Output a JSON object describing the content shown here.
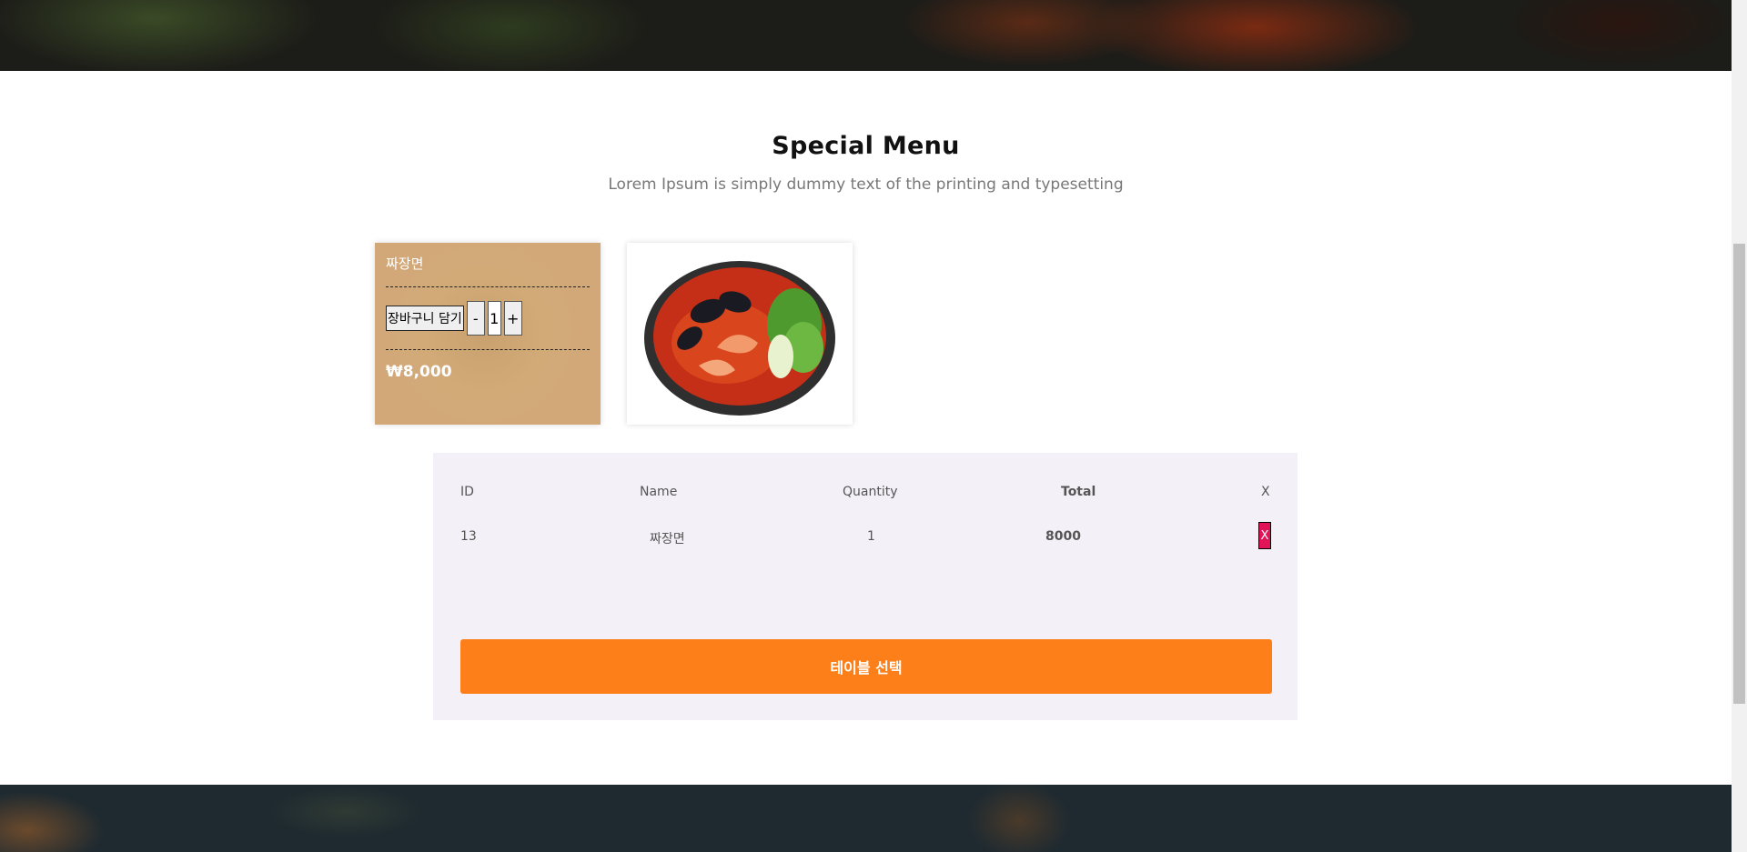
{
  "section": {
    "title": "Special Menu",
    "subtitle": "Lorem Ipsum is simply dummy text of the printing and typesetting"
  },
  "menu_cards": [
    {
      "name": "짜장면",
      "cart_button": "장바구니 담기",
      "minus": "-",
      "quantity": "1",
      "plus": "+",
      "price": "₩8,000"
    }
  ],
  "cart": {
    "headers": {
      "id": "ID",
      "name": "Name",
      "quantity": "Quantity",
      "total": "Total",
      "remove": "X"
    },
    "rows": [
      {
        "id": "13",
        "name": "짜장면",
        "quantity": "1",
        "total": "8000",
        "remove": "X"
      }
    ],
    "order_button": "테이블 선택"
  },
  "colors": {
    "accent": "#fd7f19",
    "delete": "#e11457",
    "panel": "#f3f1f7",
    "card": "#d2a878"
  }
}
